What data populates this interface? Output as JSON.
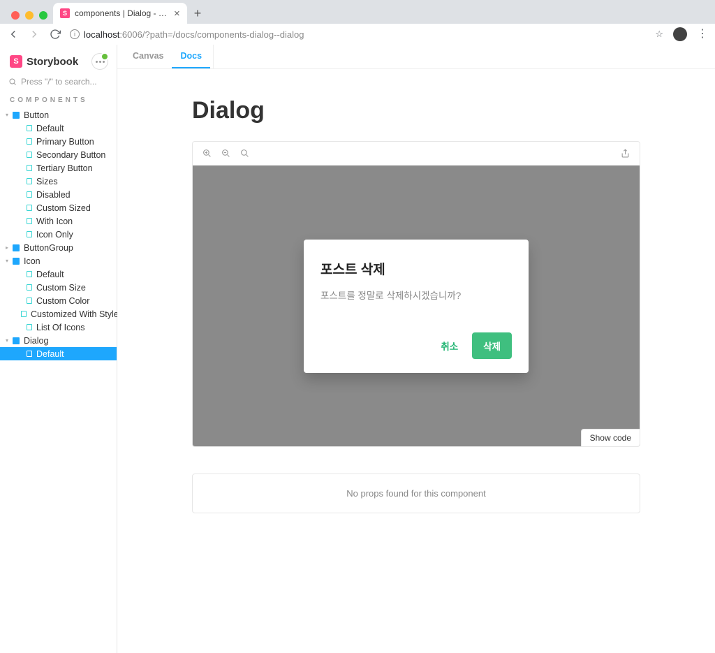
{
  "browser": {
    "tab_title": "components | Dialog - Dialog",
    "url_host": "localhost",
    "url_port": ":6006",
    "url_path": "/?path=/docs/components-dialog--dialog"
  },
  "sidebar": {
    "brand": "Storybook",
    "search_placeholder": "Press \"/\" to search...",
    "section_label": "COMPONENTS",
    "items": [
      {
        "label": "Button",
        "type": "component",
        "level": 0,
        "expanded": true
      },
      {
        "label": "Default",
        "type": "story",
        "level": 1
      },
      {
        "label": "Primary Button",
        "type": "story",
        "level": 1
      },
      {
        "label": "Secondary Button",
        "type": "story",
        "level": 1
      },
      {
        "label": "Tertiary Button",
        "type": "story",
        "level": 1
      },
      {
        "label": "Sizes",
        "type": "story",
        "level": 1
      },
      {
        "label": "Disabled",
        "type": "story",
        "level": 1
      },
      {
        "label": "Custom Sized",
        "type": "story",
        "level": 1
      },
      {
        "label": "With Icon",
        "type": "story",
        "level": 1
      },
      {
        "label": "Icon Only",
        "type": "story",
        "level": 1
      },
      {
        "label": "ButtonGroup",
        "type": "component",
        "level": 0,
        "expanded": false
      },
      {
        "label": "Icon",
        "type": "component",
        "level": 0,
        "expanded": true
      },
      {
        "label": "Default",
        "type": "story",
        "level": 1
      },
      {
        "label": "Custom Size",
        "type": "story",
        "level": 1
      },
      {
        "label": "Custom Color",
        "type": "story",
        "level": 1
      },
      {
        "label": "Customized With Style",
        "type": "story",
        "level": 1
      },
      {
        "label": "List Of Icons",
        "type": "story",
        "level": 1
      },
      {
        "label": "Dialog",
        "type": "component",
        "level": 0,
        "expanded": true
      },
      {
        "label": "Default",
        "type": "story",
        "level": 1,
        "selected": true
      }
    ]
  },
  "tabs": {
    "canvas": "Canvas",
    "docs": "Docs"
  },
  "doc": {
    "title": "Dialog",
    "show_code": "Show code",
    "no_props": "No props found for this component"
  },
  "dialog": {
    "title": "포스트 삭제",
    "body": "포스트를 정말로 삭제하시겠습니까?",
    "cancel": "취소",
    "confirm": "삭제"
  }
}
